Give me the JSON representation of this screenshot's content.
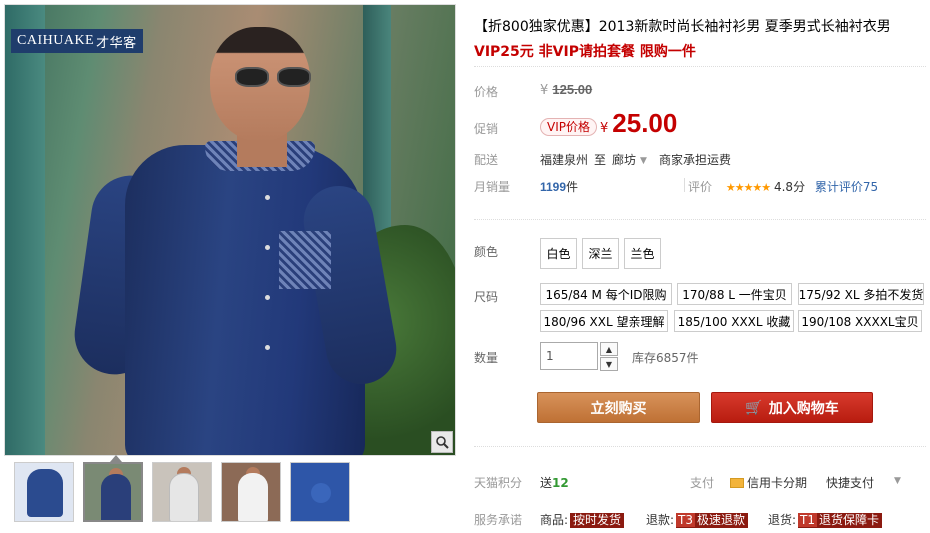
{
  "brand_logo": {
    "en": "CAIHUAKE",
    "cn": "才华客"
  },
  "zoom_icon": "magnifier-icon",
  "thumbnails": [
    {
      "color": "#2b4b8f",
      "type": "shirt-flat"
    },
    {
      "color": "#2a3f7a",
      "type": "model-blue"
    },
    {
      "color": "#e6e6e6",
      "type": "model-grey"
    },
    {
      "color": "#f2f2f2",
      "type": "model-white"
    },
    {
      "color": "#2e56a8",
      "type": "detail-blue"
    }
  ],
  "product": {
    "title": "【折800独家优惠】2013新款时尚长袖衬衫男 夏季男式长袖衬衣男",
    "subtitle": "VIP25元 非VIP请拍套餐 限购一件"
  },
  "price": {
    "label": "价格",
    "currency": "¥",
    "original": "125.00",
    "promo_label": "促销",
    "vip_badge": "VIP价格",
    "promo": "25.00"
  },
  "shipping": {
    "label": "配送",
    "from": "福建泉州",
    "to_word": "至",
    "to": "廊坊",
    "freight": "商家承担运费"
  },
  "sales": {
    "label": "月销量",
    "count": "1199",
    "unit": "件",
    "rating_label": "评价",
    "stars": "★★★★★",
    "score": "4.8分",
    "review_count": "累计评价75"
  },
  "color": {
    "label": "颜色",
    "options": [
      "白色",
      "深兰",
      "兰色"
    ]
  },
  "size": {
    "label": "尺码",
    "options": [
      "165/84 M 每个ID限购",
      "170/88 L 一件宝贝",
      "175/92 XL 多拍不发货",
      "180/96 XXL 望亲理解",
      "185/100 XXXL 收藏",
      "190/108 XXXXL宝贝"
    ]
  },
  "quantity": {
    "label": "数量",
    "value": "1",
    "up_icon": "▲",
    "down_icon": "▼",
    "stock": "库存6857件"
  },
  "actions": {
    "buy_now": "立刻购买",
    "add_to_cart": "加入购物车",
    "cart_icon": "🛒"
  },
  "tmall_points": {
    "label": "天猫积分",
    "prefix": "送",
    "value": "12"
  },
  "payment": {
    "label": "支付",
    "credit": "信用卡分期",
    "fast": "快捷支付"
  },
  "service": {
    "label": "服务承诺",
    "items": [
      {
        "prefix": "商品:",
        "tag": "按时发货",
        "pre": ""
      },
      {
        "prefix": "退款:",
        "tag": "极速退款",
        "pre": "T3"
      },
      {
        "prefix": "退货:",
        "tag": "退货保障卡",
        "pre": "T1"
      }
    ]
  }
}
